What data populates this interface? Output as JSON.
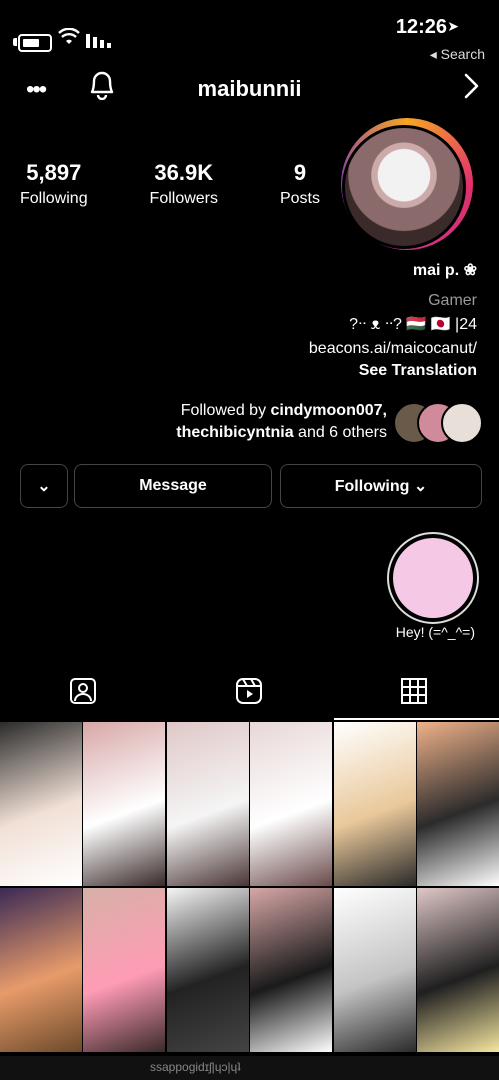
{
  "status_bar": {
    "time": "12:26",
    "back_label": "◂ Search"
  },
  "header": {
    "username": "maibunnii"
  },
  "profile": {
    "stats": [
      {
        "value": "9",
        "label": "Posts"
      },
      {
        "value": "36.9K",
        "label": "Followers"
      },
      {
        "value": "5,897",
        "label": "Following"
      }
    ],
    "display_name": "mai p. ❀",
    "category": "Gamer",
    "bio_line": "?ᐧᐧ ᴥ ᐧᐧ? 🇭🇺 🇯🇵 |24",
    "link": "beacons.ai/maicocanut/",
    "see_translation": "See Translation",
    "followed_by_prefix": "Followed by ",
    "followed_by_user": "cindymoon007,",
    "followed_by_user2": "thechibicyntnia",
    "followed_by_suffix": " and 6 others"
  },
  "buttons": {
    "following": "Following ⌄",
    "message": "Message",
    "more": "⌄"
  },
  "highlight": {
    "label": "Hey! (=^_^=)"
  },
  "grid": {
    "cells": [
      {
        "colors": [
          "#2b2b2b",
          "#f1e0d6",
          "#ffffff"
        ]
      },
      {
        "colors": [
          "#d8a7a7",
          "#ffffff",
          "#3a2a2a"
        ]
      },
      {
        "colors": [
          "#e0c7c7",
          "#f5f5f5",
          "#4a3535"
        ]
      },
      {
        "colors": [
          "#e8d7d7",
          "#ffffff",
          "#6a4a4a"
        ]
      },
      {
        "colors": [
          "#ffffff",
          "#e9c89a",
          "#2a2a2a"
        ]
      },
      {
        "colors": [
          "#f0b28a",
          "#2b2b2b",
          "#ffffff"
        ]
      },
      {
        "colors": [
          "#3a2a55",
          "#e89b6a",
          "#6b4a2a"
        ]
      },
      {
        "colors": [
          "#d7b1a7",
          "#ff9bb5",
          "#3a2a2a"
        ]
      },
      {
        "colors": [
          "#f5f5f5",
          "#222222",
          "#444444"
        ]
      },
      {
        "colors": [
          "#d8a7a7",
          "#1a1a1a",
          "#ffffff"
        ]
      },
      {
        "colors": [
          "#ffffff",
          "#c4c4c4",
          "#2a2a2a"
        ]
      },
      {
        "colors": [
          "#e0c7c7",
          "#1f1f1f",
          "#f5e6a0"
        ]
      }
    ]
  },
  "bottom_strip": {
    "text": "ssappogidɪʃ|ɥɔ|ɥʇ"
  },
  "colors": {
    "background": "#000000",
    "secondary_text": "#9a9a9a",
    "button_border": "#444444",
    "highlight_fill": "#f5c8e6"
  },
  "icons": [
    "battery-icon",
    "wifi-icon",
    "signal-icon",
    "more-icon",
    "bell-icon",
    "chevron-right-icon",
    "grid-icon",
    "reels-icon",
    "tagged-icon"
  ]
}
